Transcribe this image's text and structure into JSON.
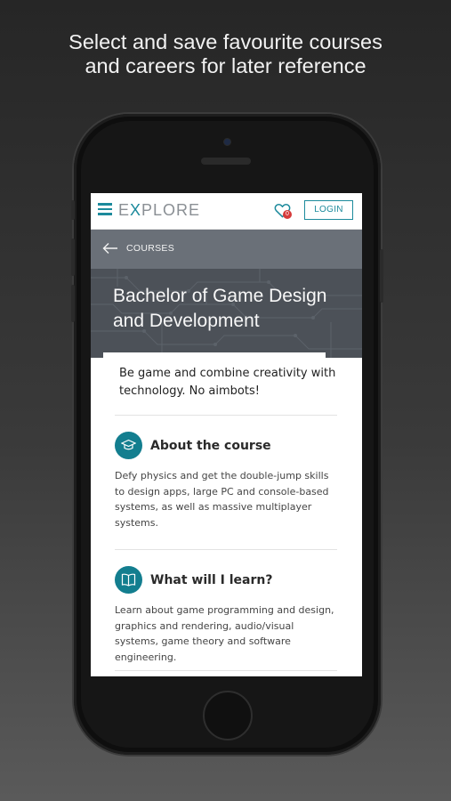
{
  "promo": {
    "line1": "Select and save favourite courses",
    "line2": "and careers for later reference"
  },
  "app": {
    "logo_prefix": "E",
    "logo_x": "X",
    "logo_suffix": "PLORE",
    "favourites_count": "0",
    "login_label": "LOGIN"
  },
  "breadcrumb": {
    "label": "COURSES"
  },
  "course": {
    "title_line1": "Bachelor of Game Design",
    "title_line2": "and Development",
    "intro": "Be game and combine creativity with technology. No aimbots!"
  },
  "sections": [
    {
      "icon": "graduation-cap-icon",
      "title": "About the course",
      "body": "Defy physics and get the double-jump skills to design apps, large PC and console-based systems, as well as massive multiplayer systems."
    },
    {
      "icon": "book-icon",
      "title": "What will I learn?",
      "body": "Learn about game programming and design, graphics and rendering, audio/visual systems, game theory and software engineering."
    }
  ],
  "colors": {
    "accent": "#1c8a9c",
    "icon_circle": "#137e8f",
    "breadcrumb_bg": "#6a7078",
    "hero_bg": "#4c5158",
    "badge": "#d63b3b"
  }
}
